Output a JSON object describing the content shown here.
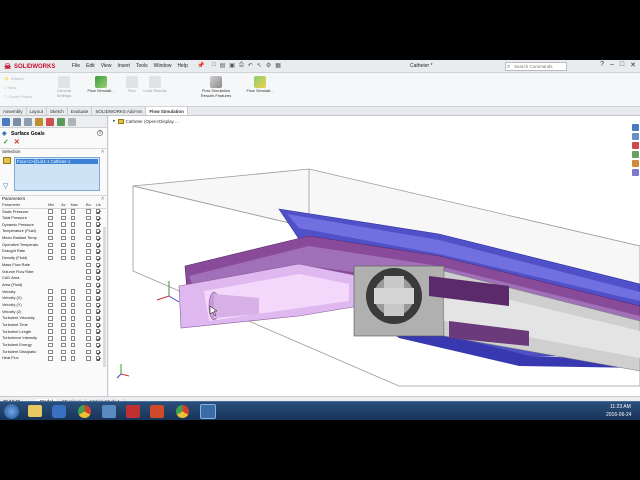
{
  "app": {
    "logo_text": "SOLIDWORKS",
    "menus": [
      "File",
      "Edit",
      "View",
      "Insert",
      "Tools",
      "Window",
      "Help"
    ],
    "doc_title": "Catheter *",
    "search_placeholder": "Search Commands"
  },
  "ribbon": {
    "small_items": [
      "Wizard",
      "New",
      "Clone Project"
    ],
    "items": [
      {
        "label": "General Settings",
        "active": false
      },
      {
        "label": "Flow Simulati...",
        "active": true
      },
      {
        "label": "Run",
        "active": false
      },
      {
        "label": "Load Results",
        "active": false
      },
      {
        "label": "Flow Simulation Results Features",
        "active": true
      },
      {
        "label": "Flow Simulati...",
        "active": true
      }
    ]
  },
  "command_tabs": [
    "Assembly",
    "Layout",
    "Sketch",
    "Evaluate",
    "SOLIDWORKS Add-Ins",
    "Flow Simulation"
  ],
  "selected_command_tab": "Flow Simulation",
  "property_manager": {
    "title": "Surface Goals",
    "selection_label": "Selection",
    "selected_item": "Face<1>@Lid1-1 Catheter-1",
    "parameters_label": "Parameters",
    "columns": [
      "Parameter",
      "Min",
      "Av",
      "Max",
      "Bu",
      "Us"
    ],
    "rows": [
      {
        "name": "Static Pressure",
        "checks": [
          0,
          0,
          0,
          0,
          1
        ]
      },
      {
        "name": "Total Pressure",
        "checks": [
          0,
          0,
          0,
          0,
          1
        ]
      },
      {
        "name": "Dynamic Pressure",
        "checks": [
          0,
          0,
          0,
          0,
          1
        ]
      },
      {
        "name": "Temperature (Fluid)",
        "checks": [
          0,
          0,
          0,
          0,
          1
        ]
      },
      {
        "name": "Mean Radiant Temp",
        "checks": [
          0,
          0,
          0,
          0,
          1
        ]
      },
      {
        "name": "Operative Temperatu",
        "checks": [
          0,
          0,
          0,
          0,
          1
        ]
      },
      {
        "name": "Draught Rate",
        "checks": [
          0,
          0,
          0,
          0,
          1
        ]
      },
      {
        "name": "Density (Fluid)",
        "checks": [
          0,
          0,
          0,
          0,
          1
        ]
      },
      {
        "name": "Mass Flow Rate",
        "checks": [
          -1,
          -1,
          -1,
          0,
          1
        ]
      },
      {
        "name": "Volume Flow Rate",
        "checks": [
          -1,
          -1,
          -1,
          0,
          1
        ]
      },
      {
        "name": "CAD Area",
        "checks": [
          -1,
          -1,
          -1,
          0,
          1
        ]
      },
      {
        "name": "Area (Fluid)",
        "checks": [
          -1,
          -1,
          -1,
          0,
          1
        ]
      },
      {
        "name": "Velocity",
        "checks": [
          0,
          0,
          0,
          0,
          1
        ]
      },
      {
        "name": "Velocity (X)",
        "checks": [
          0,
          0,
          0,
          0,
          1
        ]
      },
      {
        "name": "Velocity (Y)",
        "checks": [
          0,
          0,
          0,
          0,
          1
        ]
      },
      {
        "name": "Velocity (Z)",
        "checks": [
          0,
          0,
          0,
          0,
          1
        ]
      },
      {
        "name": "Turbulent Viscosity",
        "checks": [
          0,
          0,
          0,
          0,
          1
        ]
      },
      {
        "name": "Turbulent Time",
        "checks": [
          0,
          0,
          0,
          0,
          1
        ]
      },
      {
        "name": "Turbulent Length",
        "checks": [
          0,
          0,
          0,
          0,
          1
        ]
      },
      {
        "name": "Turbulence Intensity",
        "checks": [
          0,
          0,
          0,
          0,
          1
        ]
      },
      {
        "name": "Turbulent Energy",
        "checks": [
          0,
          0,
          0,
          0,
          1
        ]
      },
      {
        "name": "Turbulent Dissipatio",
        "checks": [
          0,
          0,
          0,
          0,
          1
        ]
      },
      {
        "name": "Heat Flux",
        "checks": [
          0,
          0,
          0,
          0,
          1
        ]
      }
    ]
  },
  "viewport": {
    "breadcrumb": "Catheter (Open<Display ..."
  },
  "model_tabs": [
    "Model",
    "3D Views",
    "Motion Study 1"
  ],
  "selected_model_tab": "Model",
  "status": {
    "left": "Lid1-1 * Catheter<1>",
    "fully_defined": "Fully Defined",
    "editing": "Editing Assembly",
    "units": "MMGS"
  },
  "taskbar": {
    "time": "11:23 AM",
    "date": "2016-06-24"
  },
  "colors": {
    "accent_blue": "#2a6bb5",
    "tube_purple": "#a070c0",
    "housing_blue": "#4a4ad8",
    "taskbar": "#1b3454"
  }
}
